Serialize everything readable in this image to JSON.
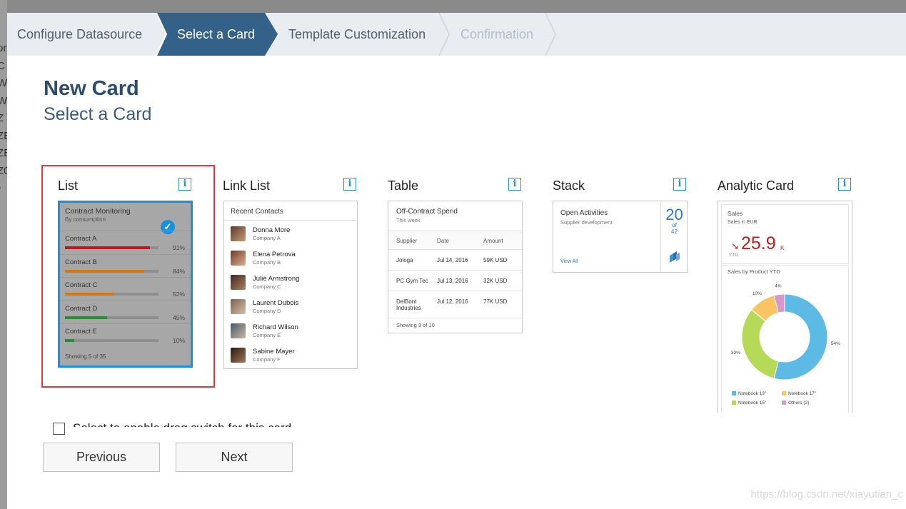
{
  "background": {
    "left_letters": [
      "or",
      "C",
      "W",
      "W",
      "Z",
      "ZE",
      "ZE",
      "Z0",
      "•"
    ]
  },
  "wizard": {
    "steps": [
      {
        "label": "Configure Datasource",
        "state": "done"
      },
      {
        "label": "Select a Card",
        "state": "active"
      },
      {
        "label": "Template Customization",
        "state": "todo"
      },
      {
        "label": "Confirmation",
        "state": "disabled"
      }
    ],
    "active_color": "#346187"
  },
  "header": {
    "title": "New Card",
    "subtitle": "Select a Card"
  },
  "cards": {
    "list": {
      "label": "List",
      "info_icon": "i",
      "preview": {
        "title": "Contract Monitoring",
        "subtitle": "By consumption",
        "check_icon": "✓",
        "rows": [
          {
            "name": "Contract A",
            "pct_label": "91%",
            "value": 0.91,
            "color": "#c0171e"
          },
          {
            "name": "Contract B",
            "pct_label": "84%",
            "value": 0.84,
            "color": "#d27812"
          },
          {
            "name": "Contract C",
            "pct_label": "52%",
            "value": 0.52,
            "color": "#d27812"
          },
          {
            "name": "Contract D",
            "pct_label": "45%",
            "value": 0.45,
            "color": "#2a8a3a"
          },
          {
            "name": "Contract E",
            "pct_label": "10%",
            "value": 0.1,
            "color": "#2a8a3a"
          }
        ],
        "footer": "Showing 5 of 35"
      }
    },
    "link_list": {
      "label": "Link List",
      "info_icon": "i",
      "preview": {
        "title": "Recent Contacts",
        "items": [
          {
            "name": "Donna More",
            "company": "Company A"
          },
          {
            "name": "Elena Petrova",
            "company": "Company B"
          },
          {
            "name": "Julie Armstrong",
            "company": "Company C"
          },
          {
            "name": "Laurent Dubois",
            "company": "Company D"
          },
          {
            "name": "Richard Wilson",
            "company": "Company E"
          },
          {
            "name": "Sabine Mayer",
            "company": "Company F"
          }
        ]
      }
    },
    "table": {
      "label": "Table",
      "info_icon": "i",
      "preview": {
        "title": "Off-Contract Spend",
        "subtitle": "This week",
        "columns": [
          "Supplier",
          "Date",
          "Amount"
        ],
        "rows": [
          [
            "Jologa",
            "Jul 14, 2016",
            "59K USD"
          ],
          [
            "PC Gym Tec",
            "Jul 13, 2016",
            "32K USD"
          ],
          [
            "DelBont Industries",
            "Jul 12, 2016",
            "77K USD"
          ]
        ],
        "footer": "Showing 3 of 10"
      }
    },
    "stack": {
      "label": "Stack",
      "info_icon": "i",
      "preview": {
        "title": "Open Activities",
        "subtitle": "Supplier development",
        "link": "View All",
        "count": "20",
        "of": "of",
        "total": "42"
      }
    },
    "analytic": {
      "label": "Analytic Card",
      "info_icon": "i",
      "preview": {
        "title": "Sales",
        "subtitle": "Sales in EUR",
        "arrow": "↘",
        "kpi": "25.9",
        "kpi_unit": "K",
        "kpi_note": "YTD",
        "chart_title": "Sales by Product YTD"
      }
    }
  },
  "chart_data": {
    "type": "pie",
    "title": "Sales by Product YTD",
    "categories": [
      "Notebook 13\"",
      "Notebook 15\"",
      "Notebook 17\"",
      "Others (2)"
    ],
    "values": [
      54,
      32,
      10,
      4
    ],
    "labels": [
      "54%",
      "32%",
      "10%",
      "4%"
    ],
    "colors": [
      "#5cbae5",
      "#b6d957",
      "#fac364",
      "#d998cb"
    ],
    "donut": true,
    "legend": "bottom"
  },
  "checkbox": {
    "label": "Select to enable drag switch for this card",
    "checked": false
  },
  "buttons": {
    "previous": "Previous",
    "next": "Next"
  },
  "watermark": "https://blog.csdn.net/xiayutian_c"
}
